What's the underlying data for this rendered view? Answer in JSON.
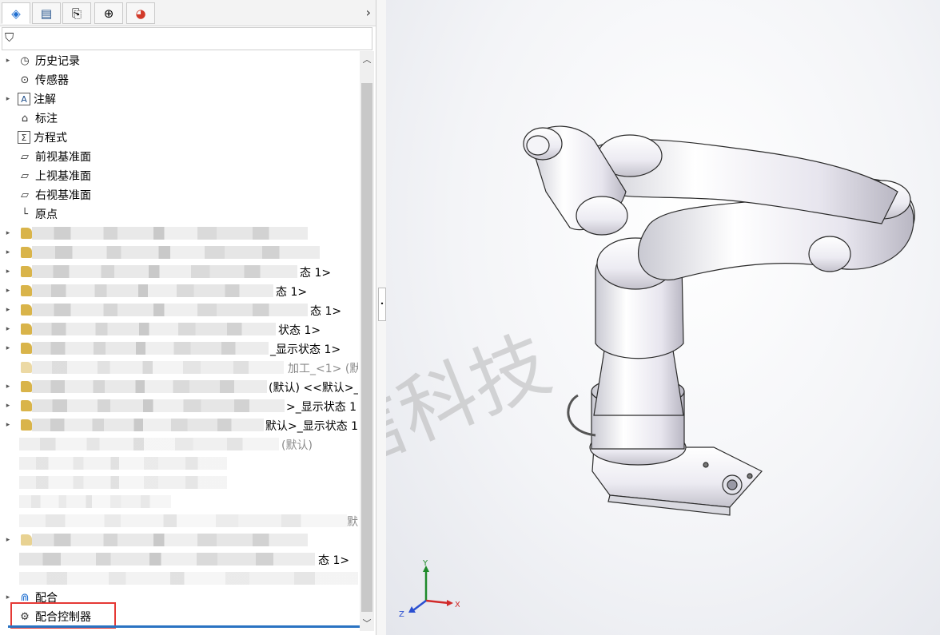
{
  "tabs": [
    {
      "name": "feature-manager",
      "icon": "◈"
    },
    {
      "name": "property-manager",
      "icon": "▤"
    },
    {
      "name": "configuration-manager",
      "icon": "⎘"
    },
    {
      "name": "dimxpert-manager",
      "icon": "⊕"
    },
    {
      "name": "display-manager",
      "icon": "◕"
    }
  ],
  "tabs_more": "›",
  "filter": {
    "icon": "⛉"
  },
  "tree": {
    "items": [
      {
        "label": "历史记录",
        "icon": "◷",
        "arrow": "▸"
      },
      {
        "label": "传感器",
        "icon": "⊙",
        "arrow": ""
      },
      {
        "label": "注解",
        "icon": "A",
        "arrow": "▸"
      },
      {
        "label": "标注",
        "icon": "⌂",
        "arrow": ""
      },
      {
        "label": "方程式",
        "icon": "Σ",
        "arrow": ""
      },
      {
        "label": "前视基准面",
        "icon": "▱",
        "arrow": ""
      },
      {
        "label": "上视基准面",
        "icon": "▱",
        "arrow": ""
      },
      {
        "label": "右视基准面",
        "icon": "▱",
        "arrow": ""
      },
      {
        "label": "原点",
        "icon": "└",
        "arrow": ""
      }
    ],
    "blurred_tails": [
      "态 1>",
      "态 1>",
      "态 1>",
      "状态 1>",
      "_显示状态 1>",
      "加工_<1> (默",
      "(默认) <<默认>_",
      ">_显示状态 1",
      "默认>_显示状态 1",
      "(默认)",
      "默",
      "态 1>"
    ],
    "mates": {
      "label": "配合",
      "icon": "⋒",
      "arrow": "▸"
    },
    "mate_controller": {
      "label": "配合控制器",
      "icon": "⚙"
    }
  },
  "viewport": {
    "watermark": "生信科技",
    "triad": {
      "x": "X",
      "y": "Y",
      "z": "Z"
    }
  }
}
